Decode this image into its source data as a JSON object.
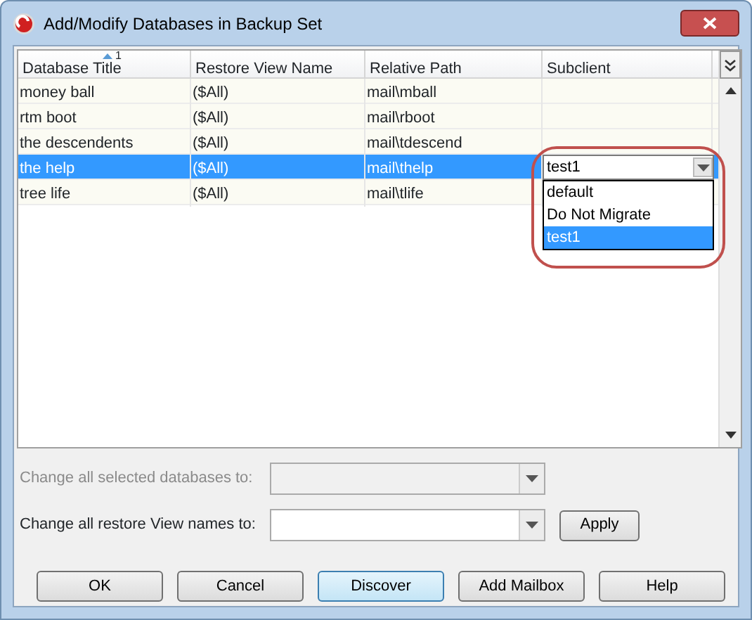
{
  "window": {
    "title": "Add/Modify Databases in Backup Set"
  },
  "table": {
    "columns": [
      {
        "label": "Database Title",
        "sort_index": "1"
      },
      {
        "label": "Restore View Name"
      },
      {
        "label": "Relative Path"
      },
      {
        "label": "Subclient"
      }
    ],
    "rows": [
      {
        "cells": [
          "money ball",
          "($All)",
          "mail\\mball",
          ""
        ],
        "selected": false
      },
      {
        "cells": [
          "rtm boot",
          "($All)",
          "mail\\rboot",
          ""
        ],
        "selected": false
      },
      {
        "cells": [
          "the descendents",
          "($All)",
          "mail\\tdescend",
          ""
        ],
        "selected": false
      },
      {
        "cells": [
          "the help",
          "($All)",
          "mail\\thelp",
          ""
        ],
        "selected": true,
        "subclient_editor": {
          "value": "test1",
          "options": [
            {
              "label": "default",
              "selected": false
            },
            {
              "label": "Do Not Migrate",
              "selected": false
            },
            {
              "label": "test1",
              "selected": true
            }
          ]
        }
      },
      {
        "cells": [
          "tree life",
          "($All)",
          "mail\\tlife",
          ""
        ],
        "selected": false
      }
    ]
  },
  "fields": [
    {
      "label": "Change all selected databases to:",
      "disabled": true
    },
    {
      "label": "Change all restore View names to:",
      "disabled": false,
      "button": "Apply"
    }
  ],
  "buttons": [
    {
      "label": "OK",
      "focused": false
    },
    {
      "label": "Cancel",
      "focused": false
    },
    {
      "label": "Discover",
      "focused": true
    },
    {
      "label": "Add Mailbox",
      "focused": false
    },
    {
      "label": "Help",
      "focused": false
    }
  ]
}
